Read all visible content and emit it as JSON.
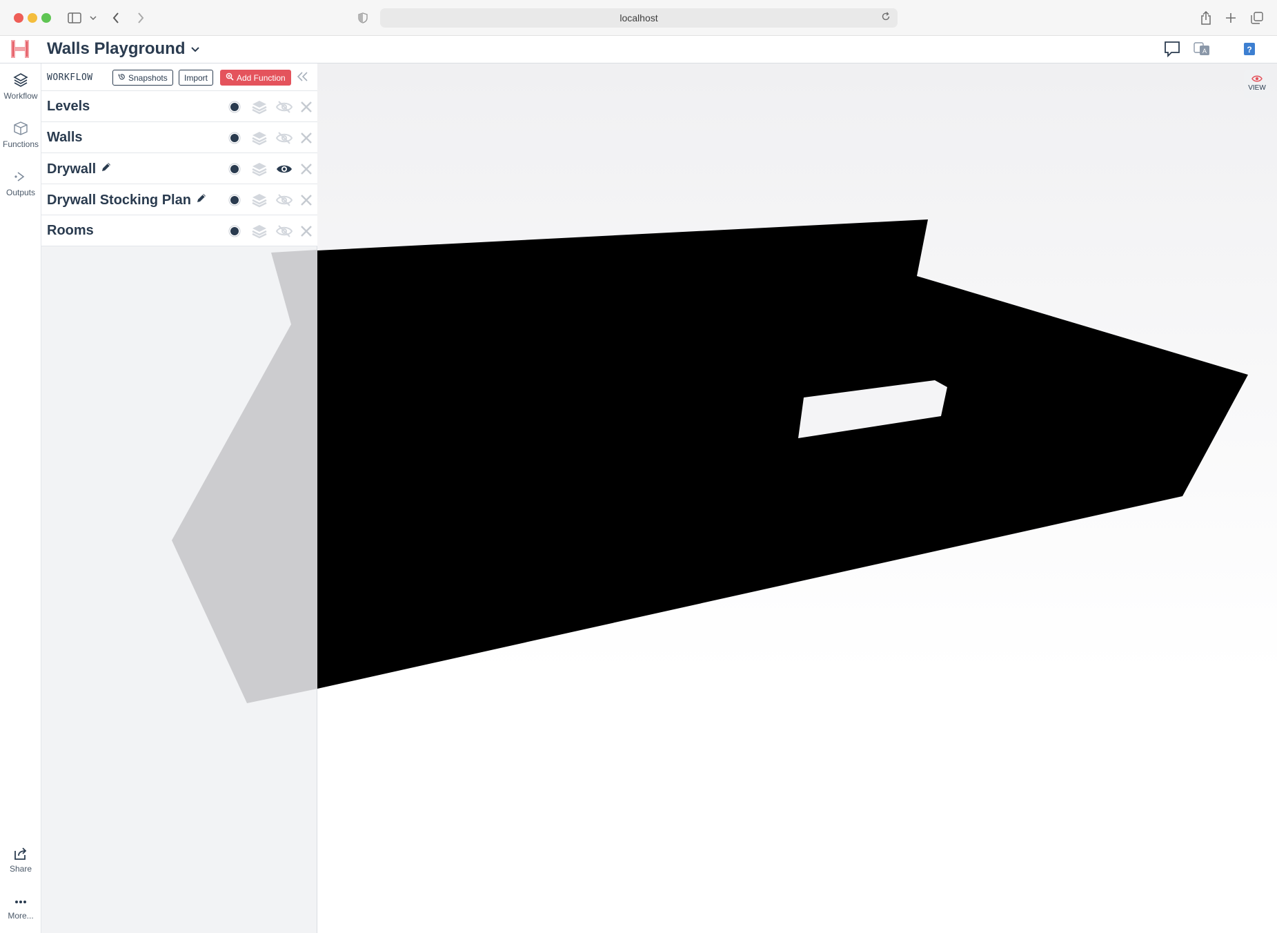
{
  "browser": {
    "url": "localhost"
  },
  "header": {
    "project_title": "Walls Playground"
  },
  "rail": {
    "items": [
      {
        "label": "Workflow",
        "icon": "layers-icon"
      },
      {
        "label": "Functions",
        "icon": "box-icon"
      },
      {
        "label": "Outputs",
        "icon": "outputs-icon"
      }
    ],
    "bottom": [
      {
        "label": "Share",
        "icon": "share-icon"
      },
      {
        "label": "More...",
        "icon": "ellipsis-icon"
      }
    ]
  },
  "workflow": {
    "label": "WORKFLOW",
    "snapshots_label": "Snapshots",
    "import_label": "Import",
    "add_function_label": "Add Function",
    "functions": [
      {
        "name": "Levels",
        "editable": false,
        "visible": false
      },
      {
        "name": "Walls",
        "editable": false,
        "visible": false
      },
      {
        "name": "Drywall",
        "editable": true,
        "visible": true
      },
      {
        "name": "Drywall Stocking Plan",
        "editable": true,
        "visible": false
      },
      {
        "name": "Rooms",
        "editable": false,
        "visible": false
      }
    ]
  },
  "viewport": {
    "view_label": "VIEW"
  },
  "colors": {
    "accent": "#e4535c",
    "text": "#2a3b4f",
    "shape_fill": "#000000",
    "shadow_fill": "#cccccf"
  }
}
